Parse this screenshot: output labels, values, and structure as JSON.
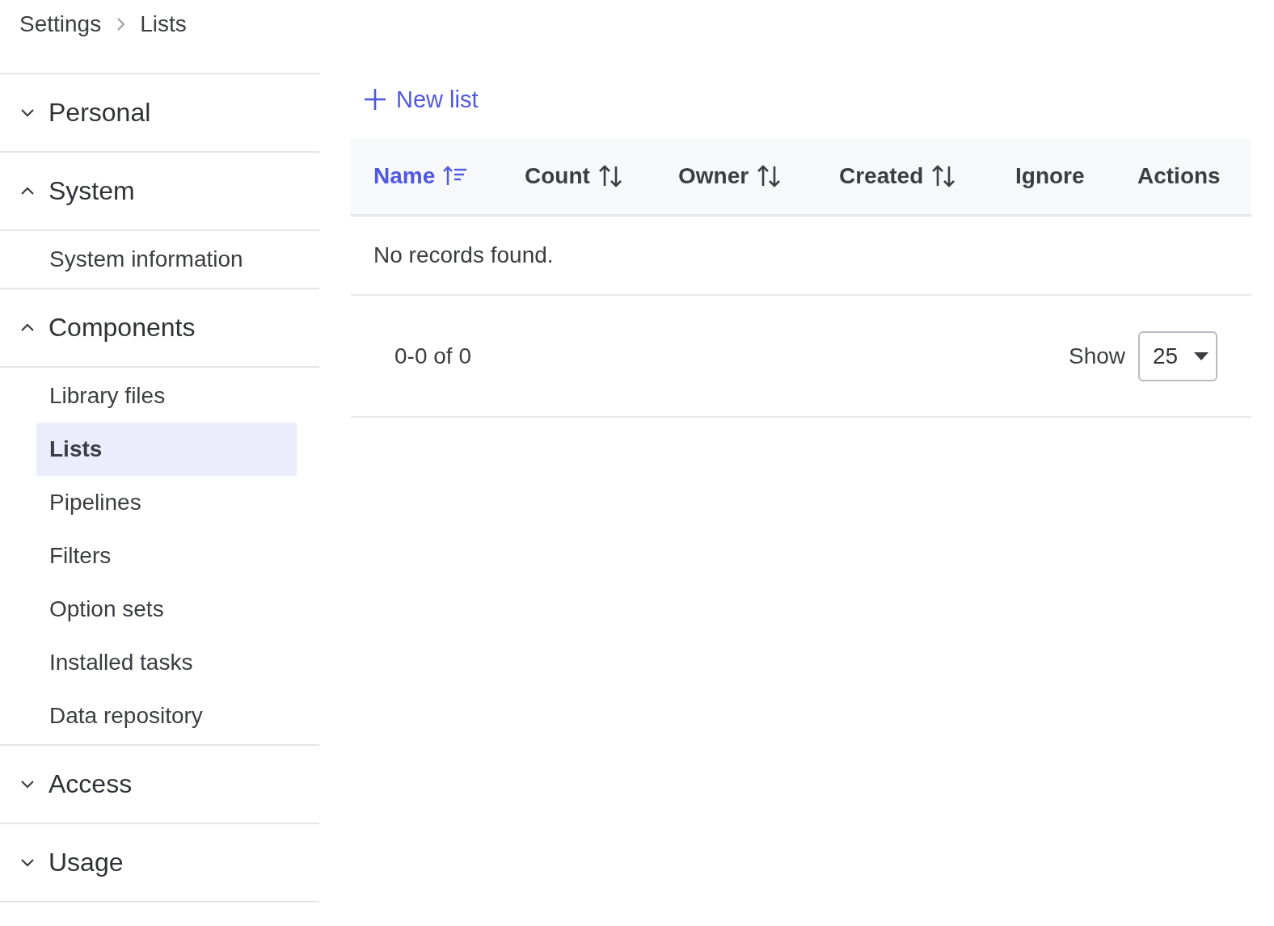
{
  "breadcrumb": [
    {
      "label": "Settings"
    },
    {
      "label": "Lists"
    }
  ],
  "sidebar": {
    "sections": [
      {
        "title": "Personal",
        "expanded": false
      },
      {
        "title": "System",
        "expanded": true,
        "items": [
          {
            "label": "System information",
            "selected": false
          }
        ]
      },
      {
        "title": "Components",
        "expanded": true,
        "items": [
          {
            "label": "Library files",
            "selected": false
          },
          {
            "label": "Lists",
            "selected": true
          },
          {
            "label": "Pipelines",
            "selected": false
          },
          {
            "label": "Filters",
            "selected": false
          },
          {
            "label": "Option sets",
            "selected": false
          },
          {
            "label": "Installed tasks",
            "selected": false
          },
          {
            "label": "Data repository",
            "selected": false
          }
        ]
      },
      {
        "title": "Access",
        "expanded": false
      },
      {
        "title": "Usage",
        "expanded": false
      }
    ]
  },
  "new_list_button": "New list",
  "table": {
    "columns": [
      {
        "label": "Name",
        "kind": "sortable",
        "sorted": true
      },
      {
        "label": "Count",
        "kind": "sortable",
        "sorted": false
      },
      {
        "label": "Owner",
        "kind": "sortable",
        "sorted": false
      },
      {
        "label": "Created",
        "kind": "sortable",
        "sorted": false
      },
      {
        "label": "Ignore",
        "kind": "plain"
      },
      {
        "label": "Actions",
        "kind": "plain"
      }
    ],
    "empty_message": "No records found."
  },
  "pagination": {
    "range": "0-0 of 0",
    "show_label": "Show",
    "page_size": "25"
  }
}
